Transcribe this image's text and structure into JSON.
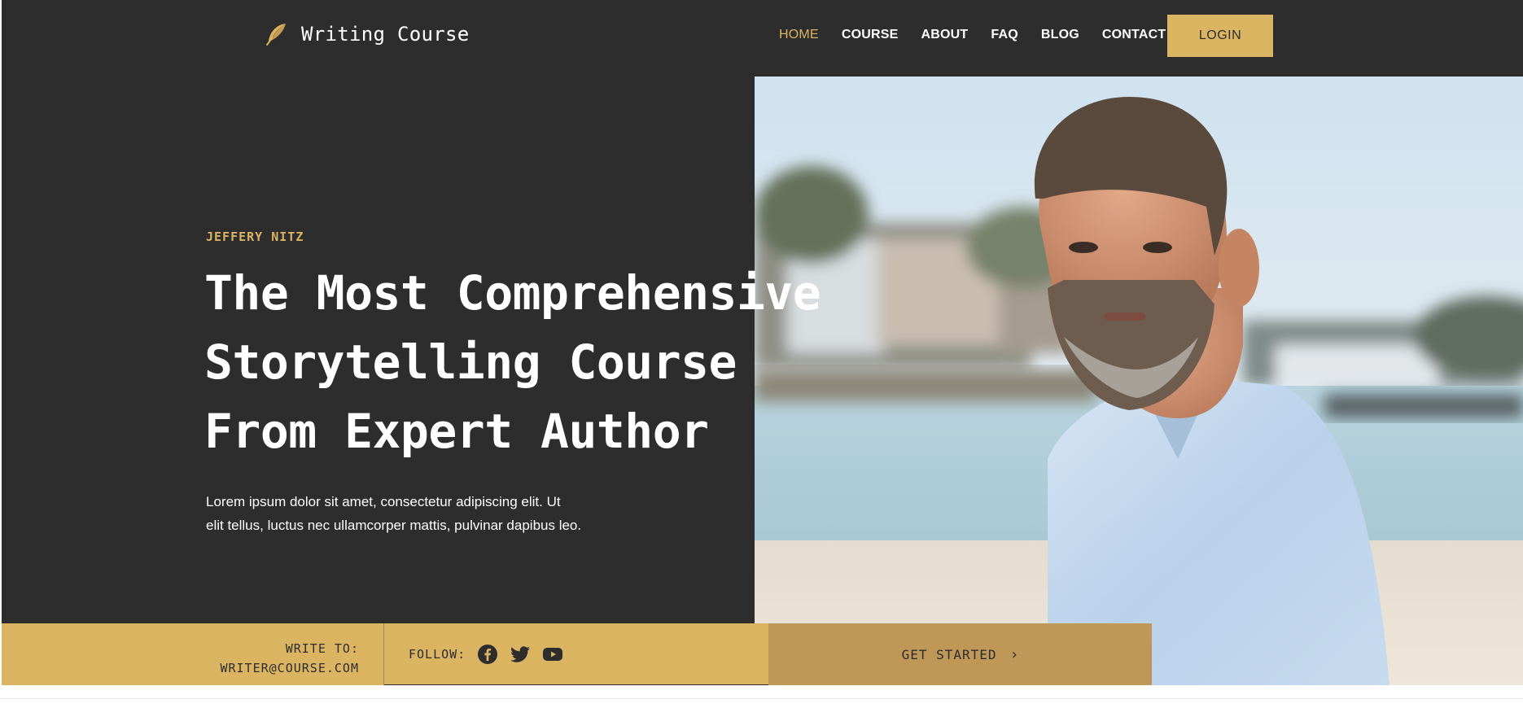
{
  "brand": {
    "name": "Writing Course",
    "icon": "feather-icon"
  },
  "nav": {
    "items": [
      {
        "label": "HOME",
        "active": true
      },
      {
        "label": "COURSE",
        "active": false
      },
      {
        "label": "ABOUT",
        "active": false
      },
      {
        "label": "FAQ",
        "active": false
      },
      {
        "label": "BLOG",
        "active": false
      },
      {
        "label": "CONTACT",
        "active": false
      }
    ],
    "login_label": "LOGIN"
  },
  "hero": {
    "eyebrow": "JEFFERY NITZ",
    "headline": [
      "The Most Comprehensive",
      "Storytelling Course",
      "From Expert Author"
    ],
    "lede_line1": "Lorem ipsum dolor sit amet, consectetur adipiscing elit. Ut",
    "lede_line2": "elit tellus, luctus nec ullamcorper mattis, pulvinar dapibus leo."
  },
  "footer_bar": {
    "write_to_label": "WRITE TO:",
    "email": "WRITER@COURSE.COM",
    "follow_label": "FOLLOW:",
    "social": [
      "facebook-icon",
      "twitter-icon",
      "youtube-icon"
    ],
    "cta_label": "GET STARTED",
    "cta_icon": "chevron-right-icon"
  },
  "colors": {
    "dark": "#2e2d2e",
    "accent": "#dbb461",
    "accent_dark": "#bf9757",
    "white": "#ffffff"
  }
}
